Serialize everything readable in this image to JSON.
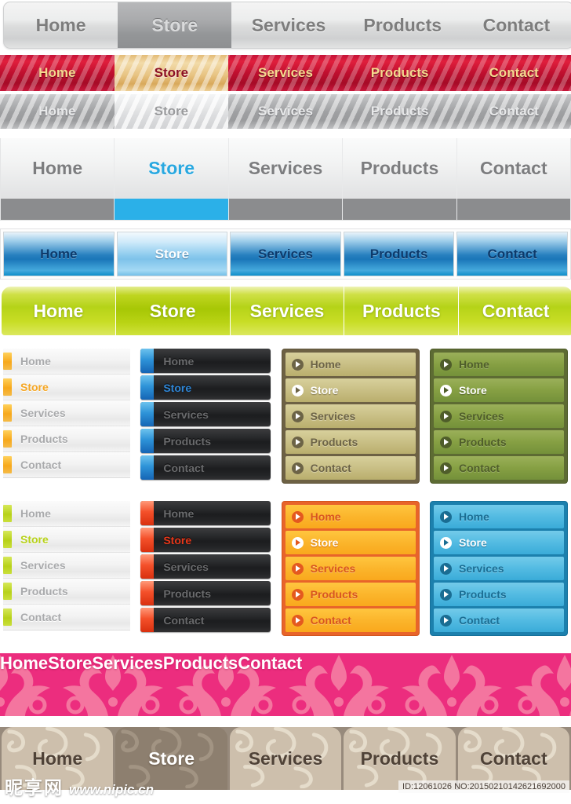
{
  "nav_items": [
    "Home",
    "Store",
    "Services",
    "Products",
    "Contact"
  ],
  "active_item": "Store",
  "bars": {
    "silver": {
      "name": "Silver rounded navigation bar"
    },
    "red_stripe": {
      "name": "Red diagonal stripe navigation bar"
    },
    "silver_stripe": {
      "name": "Silver diagonal stripe navigation bar"
    },
    "grey_tabs": {
      "name": "Grey tab bar with blue active underline"
    },
    "blue_buttons": {
      "name": "Blue gradient button bar"
    },
    "green": {
      "name": "Lime green navigation bar"
    },
    "pink_damask": {
      "name": "Pink damask ornament navigation bar"
    },
    "tan_swirl": {
      "name": "Tan swirl tab navigation bar"
    }
  },
  "menus": {
    "amber_light": {
      "name": "Light list with amber markers"
    },
    "dark_blue": {
      "name": "Dark list with blue tabs"
    },
    "olive": {
      "name": "Olive framed list"
    },
    "grass": {
      "name": "Green framed list"
    },
    "lime_light": {
      "name": "Light list with lime markers"
    },
    "dark_red": {
      "name": "Dark list with red tabs"
    },
    "orange": {
      "name": "Orange framed list"
    },
    "cyan": {
      "name": "Cyan framed list"
    }
  },
  "colors": {
    "silver_bg": "#dcdddd",
    "red": "#bf0f2f",
    "gold": "#e8c483",
    "blue_accent": "#2bb0e8",
    "blue_button": "#2881c0",
    "green": "#b5d318",
    "amber": "#f7a81b",
    "lime": "#b7d119",
    "olive": "#c9bf85",
    "grass": "#86a043",
    "orange": "#fbb52c",
    "cyan": "#53bbe2",
    "pink": "#ec2d7e",
    "tan": "#cdbfac",
    "dark_row": "#1c1d1f"
  },
  "watermark": {
    "site_cn": "昵享网",
    "url": "www.nipic.cn",
    "id_text": "ID:12061026 NO:20150210142621692000"
  }
}
